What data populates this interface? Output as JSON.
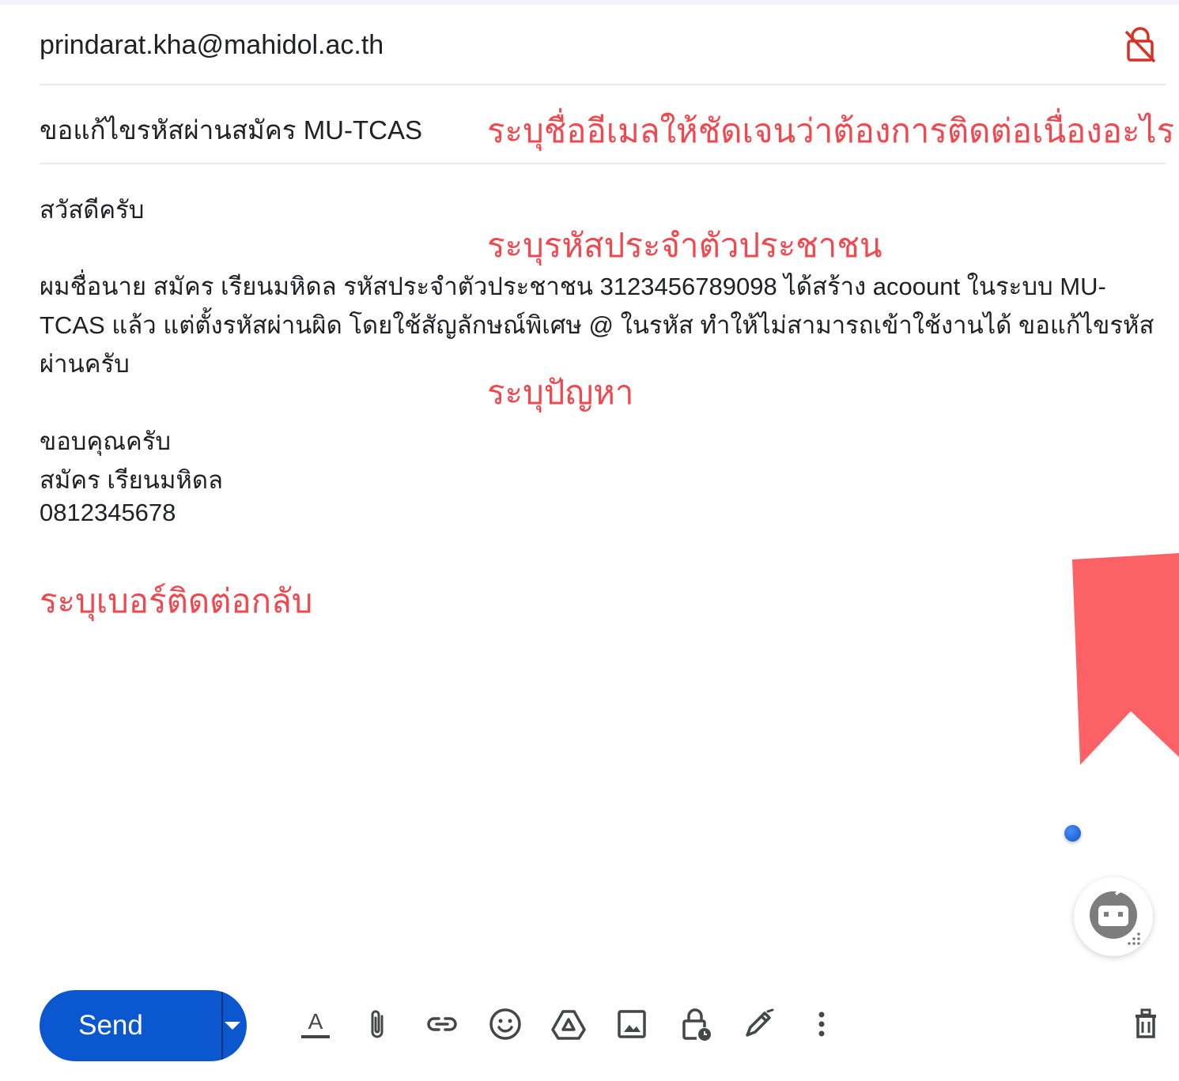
{
  "compose": {
    "to": "prindarat.kha@mahidol.ac.th",
    "subject": "ขอแก้ไขรหัสผ่านสมัคร MU-TCAS",
    "body": {
      "greeting": "สวัสดีครับ",
      "paragraph_lines": [
        "ผมชื่อนาย สมัคร เรียนมหิดล รหัสประจำตัวประชาชน 3123456789098 ได้สร้าง acoount ในระบบ MU-",
        "TCAS แล้ว แต่ตั้งรหัสผ่านผิด โดยใช้สัญลักษณ์พิเศษ @ ในรหัส ทำให้ไม่สามารถเข้าใช้งานได้ ขอแก้ไขรหัส",
        "ผ่านครับ"
      ],
      "signature_lines": [
        "ขอบคุณครับ",
        "สมัคร เรียนมหิดล",
        "0812345678"
      ]
    }
  },
  "annotations": {
    "subject_hint": "ระบุชื่ออีเมลให้ชัดเจนว่าต้องการติดต่อเนื่องอะไร",
    "id_hint": "ระบุรหัสประจำตัวประชาชน",
    "problem_hint": "ระบุปัญหา",
    "phone_hint": "ระบุเบอร์ติดต่อกลับ"
  },
  "toolbar": {
    "send_label": "Send",
    "icons": [
      "format-text-icon",
      "attach-file-icon",
      "insert-link-icon",
      "insert-emoji-icon",
      "google-drive-icon",
      "insert-photo-icon",
      "confidential-mode-icon",
      "signature-icon",
      "more-options-icon",
      "discard-trash-icon"
    ]
  },
  "colors": {
    "annotation": "#f0484e",
    "send_button": "#0b57d0",
    "ribbon": "#fc6166",
    "text": "#202124"
  }
}
